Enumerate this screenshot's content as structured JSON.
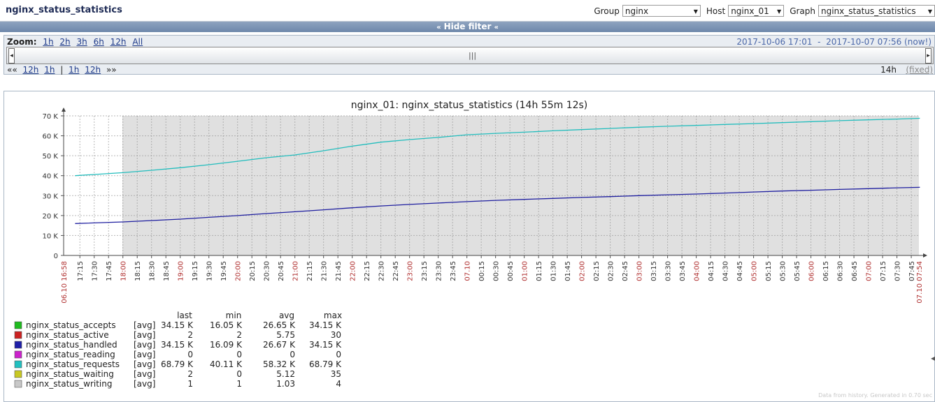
{
  "header": {
    "title": "nginx_status_statistics",
    "group_label": "Group",
    "group_value": "nginx",
    "host_label": "Host",
    "host_value": "nginx_01",
    "graph_label": "Graph",
    "graph_value": "nginx_status_statistics"
  },
  "filter_toggle": "Hide filter",
  "timeline": {
    "zoom_label": "Zoom:",
    "zoom_links": [
      "1h",
      "2h",
      "3h",
      "6h",
      "12h",
      "All"
    ],
    "range_from": "2017-10-06 17:01",
    "range_sep": "-",
    "range_to": "2017-10-07 07:56 (now!)",
    "nav_back": "««",
    "nav_back_links": [
      "12h",
      "1h"
    ],
    "nav_sep": "|",
    "nav_fwd_links": [
      "1h",
      "12h"
    ],
    "nav_fwd": "»»",
    "period": "14h",
    "fixed": "(fixed)"
  },
  "chart_data": {
    "type": "line",
    "title": "nginx_01: nginx_status_statistics (14h 55m 12s)",
    "y_ticks": [
      "0",
      "10 K",
      "20 K",
      "30 K",
      "40 K",
      "50 K",
      "60 K",
      "70 K"
    ],
    "ylim": [
      0,
      70000
    ],
    "x_ticks": [
      "17:15",
      "17:30",
      "17:45",
      "18:00",
      "18:15",
      "18:30",
      "18:45",
      "19:00",
      "19:15",
      "19:30",
      "19:45",
      "20:00",
      "20:15",
      "20:30",
      "20:45",
      "21:00",
      "21:15",
      "21:30",
      "21:45",
      "22:00",
      "22:15",
      "22:30",
      "22:45",
      "23:00",
      "23:15",
      "23:30",
      "23:45",
      "07.10",
      "00:15",
      "00:30",
      "00:45",
      "01:00",
      "01:15",
      "01:30",
      "01:45",
      "02:00",
      "02:15",
      "02:30",
      "02:45",
      "03:00",
      "03:15",
      "03:30",
      "03:45",
      "04:00",
      "04:15",
      "04:30",
      "04:45",
      "05:00",
      "05:15",
      "05:30",
      "05:45",
      "06:00",
      "06:15",
      "06:30",
      "06:45",
      "07:00",
      "07:15",
      "07:30",
      "07:45"
    ],
    "x_start_label": "06.10 16:58",
    "x_end_label": "07.10 07:54",
    "hour_marks": [
      "18:00",
      "19:00",
      "20:00",
      "21:00",
      "22:00",
      "23:00",
      "07.10",
      "01:00",
      "02:00",
      "03:00",
      "04:00",
      "05:00",
      "06:00",
      "07:00"
    ],
    "highlight_color": "#b03030",
    "plot_bg": "#e0e0e0",
    "grid": true,
    "series": [
      {
        "name": "nginx_status_requests",
        "color": "#22bdbd",
        "x": [
          "17:10",
          "18:00",
          "18:30",
          "19:00",
          "19:30",
          "20:00",
          "20:30",
          "21:00",
          "21:30",
          "22:00",
          "22:30",
          "23:00",
          "23:30",
          "00:00",
          "00:30",
          "01:00",
          "01:30",
          "02:00",
          "02:30",
          "03:00",
          "03:30",
          "04:00",
          "04:30",
          "05:00",
          "05:30",
          "06:00",
          "06:30",
          "07:00",
          "07:30",
          "07:54"
        ],
        "values": [
          40000,
          41500,
          42700,
          44000,
          45500,
          47200,
          49000,
          50400,
          52500,
          54800,
          56800,
          58100,
          59200,
          60500,
          61200,
          61800,
          62500,
          63100,
          63700,
          64300,
          64800,
          65200,
          65700,
          66100,
          66600,
          67100,
          67600,
          68000,
          68400,
          68790
        ]
      },
      {
        "name": "nginx_status_handled",
        "color": "#1f1fa0",
        "x": [
          "17:10",
          "18:00",
          "18:30",
          "19:00",
          "19:30",
          "20:00",
          "20:30",
          "21:00",
          "21:30",
          "22:00",
          "22:30",
          "23:00",
          "23:30",
          "00:00",
          "00:30",
          "01:00",
          "01:30",
          "02:00",
          "02:30",
          "03:00",
          "03:30",
          "04:00",
          "04:30",
          "05:00",
          "05:30",
          "06:00",
          "06:30",
          "07:00",
          "07:30",
          "07:54"
        ],
        "values": [
          16000,
          16800,
          17500,
          18200,
          19100,
          20000,
          21000,
          21900,
          22900,
          23900,
          24800,
          25600,
          26300,
          27000,
          27600,
          28100,
          28600,
          29100,
          29500,
          30000,
          30400,
          30800,
          31300,
          31800,
          32300,
          32700,
          33100,
          33500,
          33900,
          34150
        ]
      },
      {
        "name": "nginx_status_accepts",
        "color": "#1faa1f",
        "x": [
          "17:10",
          "07:54"
        ],
        "values": [
          16050,
          34150
        ]
      }
    ],
    "legend": {
      "headers": [
        "last",
        "min",
        "avg",
        "max"
      ],
      "rows": [
        {
          "name": "nginx_status_accepts",
          "color": "#1fbb1f",
          "agg": "[avg]",
          "last": "34.15 K",
          "min": "16.05 K",
          "avg": "26.65 K",
          "max": "34.15 K"
        },
        {
          "name": "nginx_status_active",
          "color": "#cc2222",
          "agg": "[avg]",
          "last": "2",
          "min": "2",
          "avg": "5.75",
          "max": "30"
        },
        {
          "name": "nginx_status_handled",
          "color": "#1f1fa8",
          "agg": "[avg]",
          "last": "34.15 K",
          "min": "16.09 K",
          "avg": "26.67 K",
          "max": "34.15 K"
        },
        {
          "name": "nginx_status_reading",
          "color": "#cc22cc",
          "agg": "[avg]",
          "last": "0",
          "min": "0",
          "avg": "0",
          "max": "0"
        },
        {
          "name": "nginx_status_requests",
          "color": "#22c0c0",
          "agg": "[avg]",
          "last": "68.79 K",
          "min": "40.11 K",
          "avg": "58.32 K",
          "max": "68.79 K"
        },
        {
          "name": "nginx_status_waiting",
          "color": "#c8c822",
          "agg": "[avg]",
          "last": "2",
          "min": "0",
          "avg": "5.12",
          "max": "35"
        },
        {
          "name": "nginx_status_writing",
          "color": "#c8c8c8",
          "agg": "[avg]",
          "last": "1",
          "min": "1",
          "avg": "1.03",
          "max": "4"
        }
      ]
    }
  },
  "footer_note": "Data from history. Generated in 0.70 sec"
}
